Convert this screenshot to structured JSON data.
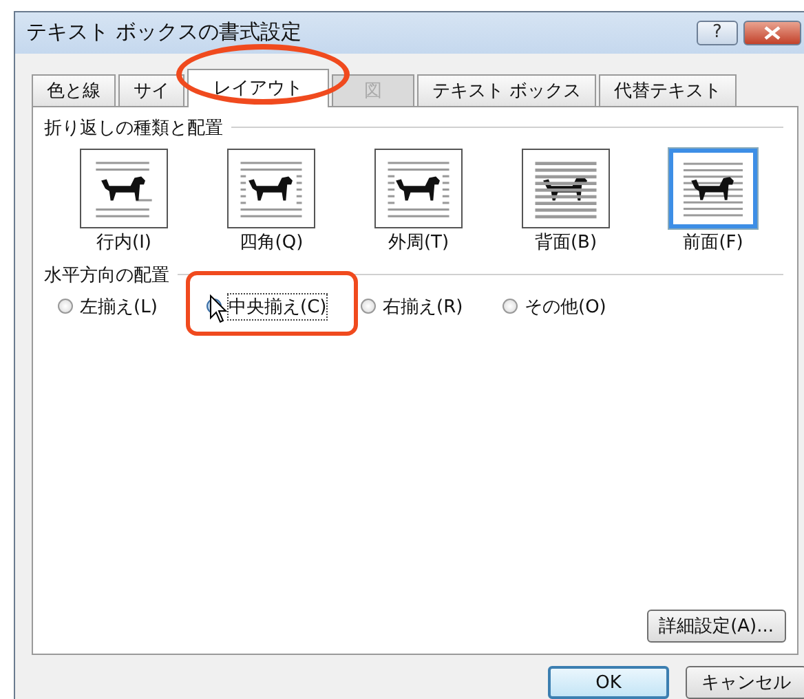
{
  "window": {
    "title": "テキスト ボックスの書式設定",
    "help_button": "?"
  },
  "tabs": [
    {
      "label": "色と線",
      "selected": false,
      "disabled": false
    },
    {
      "label": "サイ",
      "selected": false,
      "disabled": false
    },
    {
      "label": "レイアウト",
      "selected": true,
      "disabled": false
    },
    {
      "label": "図",
      "selected": false,
      "disabled": true
    },
    {
      "label": "テキスト ボックス",
      "selected": false,
      "disabled": false
    },
    {
      "label": "代替テキスト",
      "selected": false,
      "disabled": false
    }
  ],
  "wrap_section": {
    "title": "折り返しの種類と配置",
    "options": [
      {
        "kind": "inline",
        "label": "行内(I)",
        "selected": false
      },
      {
        "kind": "square",
        "label": "四角(Q)",
        "selected": false
      },
      {
        "kind": "tight",
        "label": "外周(T)",
        "selected": false
      },
      {
        "kind": "behind",
        "label": "背面(B)",
        "selected": false
      },
      {
        "kind": "front",
        "label": "前面(F)",
        "selected": true
      }
    ]
  },
  "horizontal_section": {
    "title": "水平方向の配置",
    "options": [
      {
        "label": "左揃え(L)",
        "selected": false
      },
      {
        "label": "中央揃え(C)",
        "selected": true
      },
      {
        "label": "右揃え(R)",
        "selected": false
      },
      {
        "label": "その他(O)",
        "selected": false
      }
    ]
  },
  "advanced_button": "詳細設定(A)...",
  "buttons": [
    {
      "label": "OK",
      "kind": "default"
    },
    {
      "label": "キャンセル",
      "kind": "normal"
    }
  ]
}
